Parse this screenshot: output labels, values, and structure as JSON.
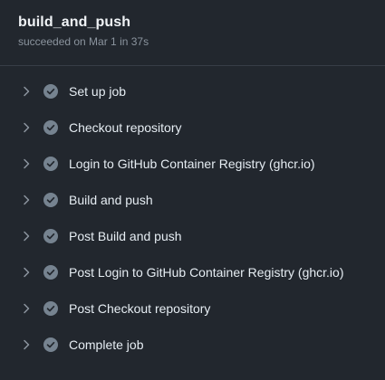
{
  "job": {
    "title": "build_and_push",
    "status": "succeeded on Mar 1 in 37s"
  },
  "colors": {
    "background": "#22272e",
    "divider": "#373e47",
    "check_circle": "#768390",
    "check_mark": "#22272e",
    "chevron": "#8b949e",
    "text": "#e6edf3",
    "muted_text": "#8b949e"
  },
  "icons": {
    "expand": "chevron-right-icon",
    "status": "check-circle-icon"
  },
  "steps": [
    {
      "label": "Set up job"
    },
    {
      "label": "Checkout repository"
    },
    {
      "label": "Login to GitHub Container Registry (ghcr.io)"
    },
    {
      "label": "Build and push"
    },
    {
      "label": "Post Build and push"
    },
    {
      "label": "Post Login to GitHub Container Registry (ghcr.io)"
    },
    {
      "label": "Post Checkout repository"
    },
    {
      "label": "Complete job"
    }
  ]
}
